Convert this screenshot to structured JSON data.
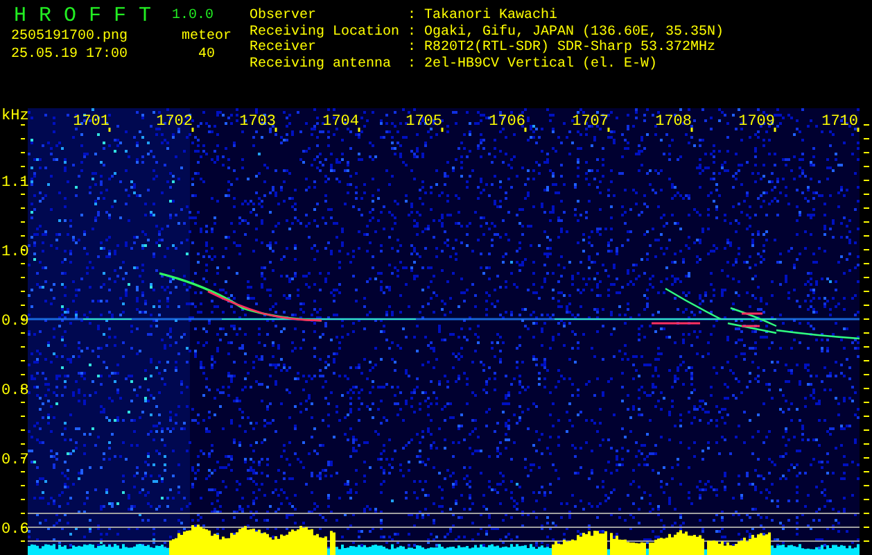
{
  "app": {
    "title": "H R O F F T",
    "version": "1.0.0"
  },
  "image_file": "2505191700.png",
  "timestamp": "25.05.19 17:00",
  "counter": {
    "label": "meteor",
    "value": "40"
  },
  "info": [
    {
      "label": "Observer",
      "separator": ":",
      "value": "Takanori Kawachi"
    },
    {
      "label": "Receiving Location",
      "separator": ":",
      "value": "Ogaki, Gifu, JAPAN (136.60E, 35.35N)"
    },
    {
      "label": "Receiver",
      "separator": ":",
      "value": "R820T2(RTL-SDR) SDR-Sharp 53.372MHz"
    },
    {
      "label": "Receiving antenna",
      "separator": ":",
      "value": "2el-HB9CV Vertical (el. E-W)"
    }
  ],
  "spectrogram": {
    "y_unit": "kHz",
    "x_labels": [
      "1701",
      "1702",
      "1703",
      "1704",
      "1705",
      "1706",
      "1707",
      "1708",
      "1709",
      "1710"
    ],
    "y_labels": [
      "1.1",
      "1.0",
      "0.9",
      "0.8",
      "0.7",
      "0.6"
    ]
  }
}
